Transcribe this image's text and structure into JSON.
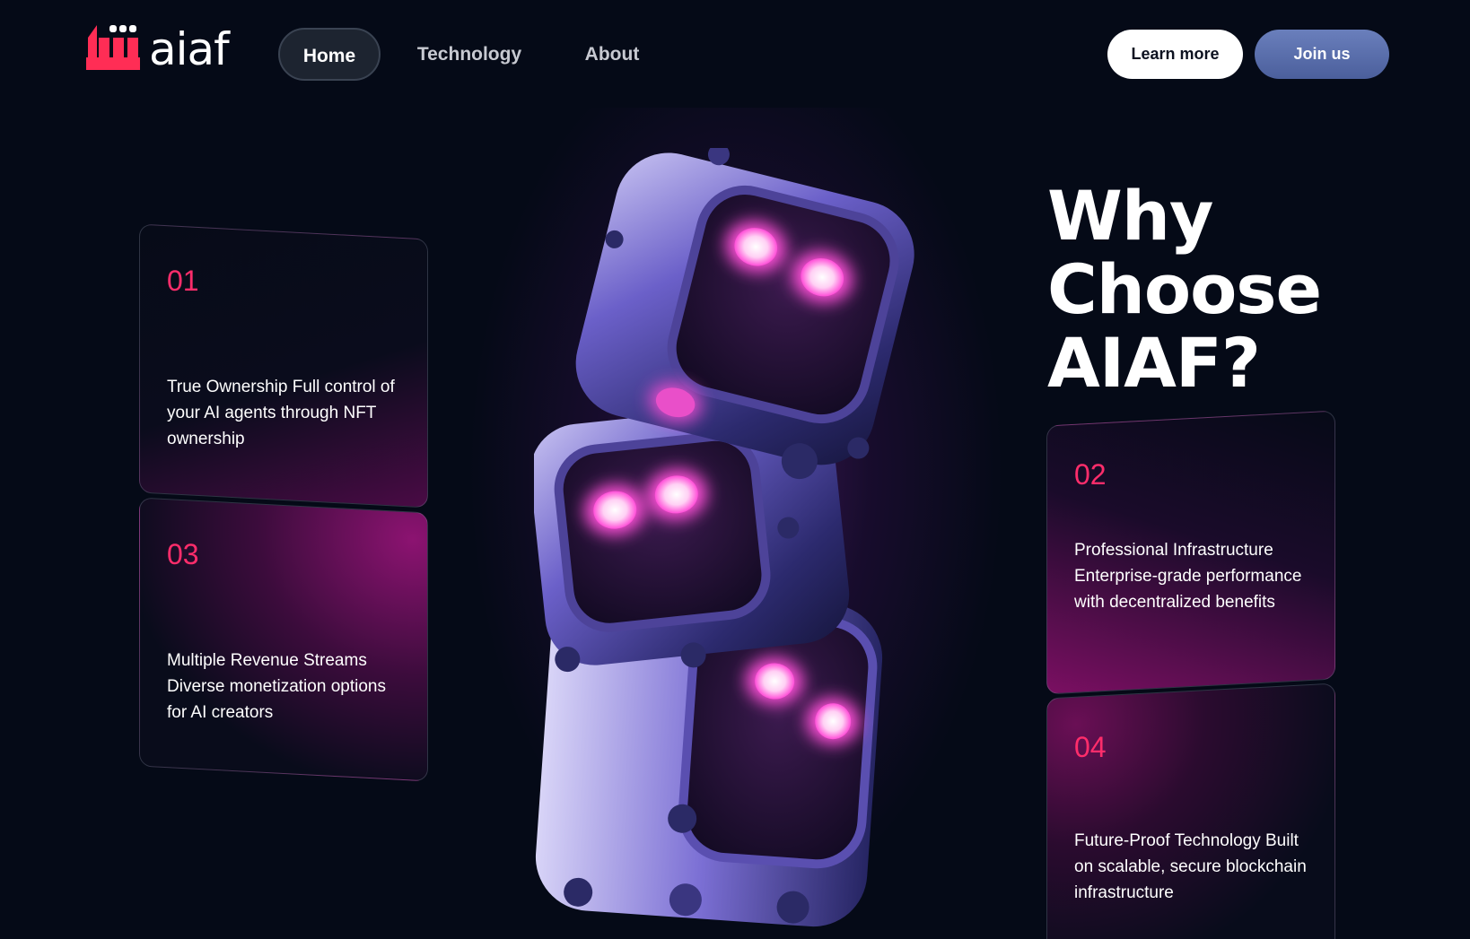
{
  "nav": {
    "logo_text": "aiaf",
    "links": [
      {
        "label": "Home",
        "active": true
      },
      {
        "label": "Technology",
        "active": false
      },
      {
        "label": "About",
        "active": false
      }
    ],
    "learn_more_label": "Learn more",
    "join_label": "Join us"
  },
  "hero": {
    "heading_line1": "Why",
    "heading_line2": "Choose",
    "heading_line3": "AIAF?"
  },
  "features": [
    {
      "number": "01",
      "text": "True Ownership Full control of your AI agents through NFT ownership"
    },
    {
      "number": "02",
      "text": "Professional Infrastructure Enterprise-grade performance with decentralized benefits"
    },
    {
      "number": "03",
      "text": "Multiple Revenue Streams Diverse monetization options for AI creators"
    },
    {
      "number": "04",
      "text": "Future-Proof Technology Built on scalable, secure blockchain infrastructure"
    }
  ],
  "colors": {
    "background": "#050a17",
    "accent": "#ff2d6b",
    "join_button": "#5a6fae",
    "glow": "#ff4fd8"
  },
  "icons": {
    "logo": "factory-logo-icon",
    "illustration": "stacked-robots-illustration"
  }
}
